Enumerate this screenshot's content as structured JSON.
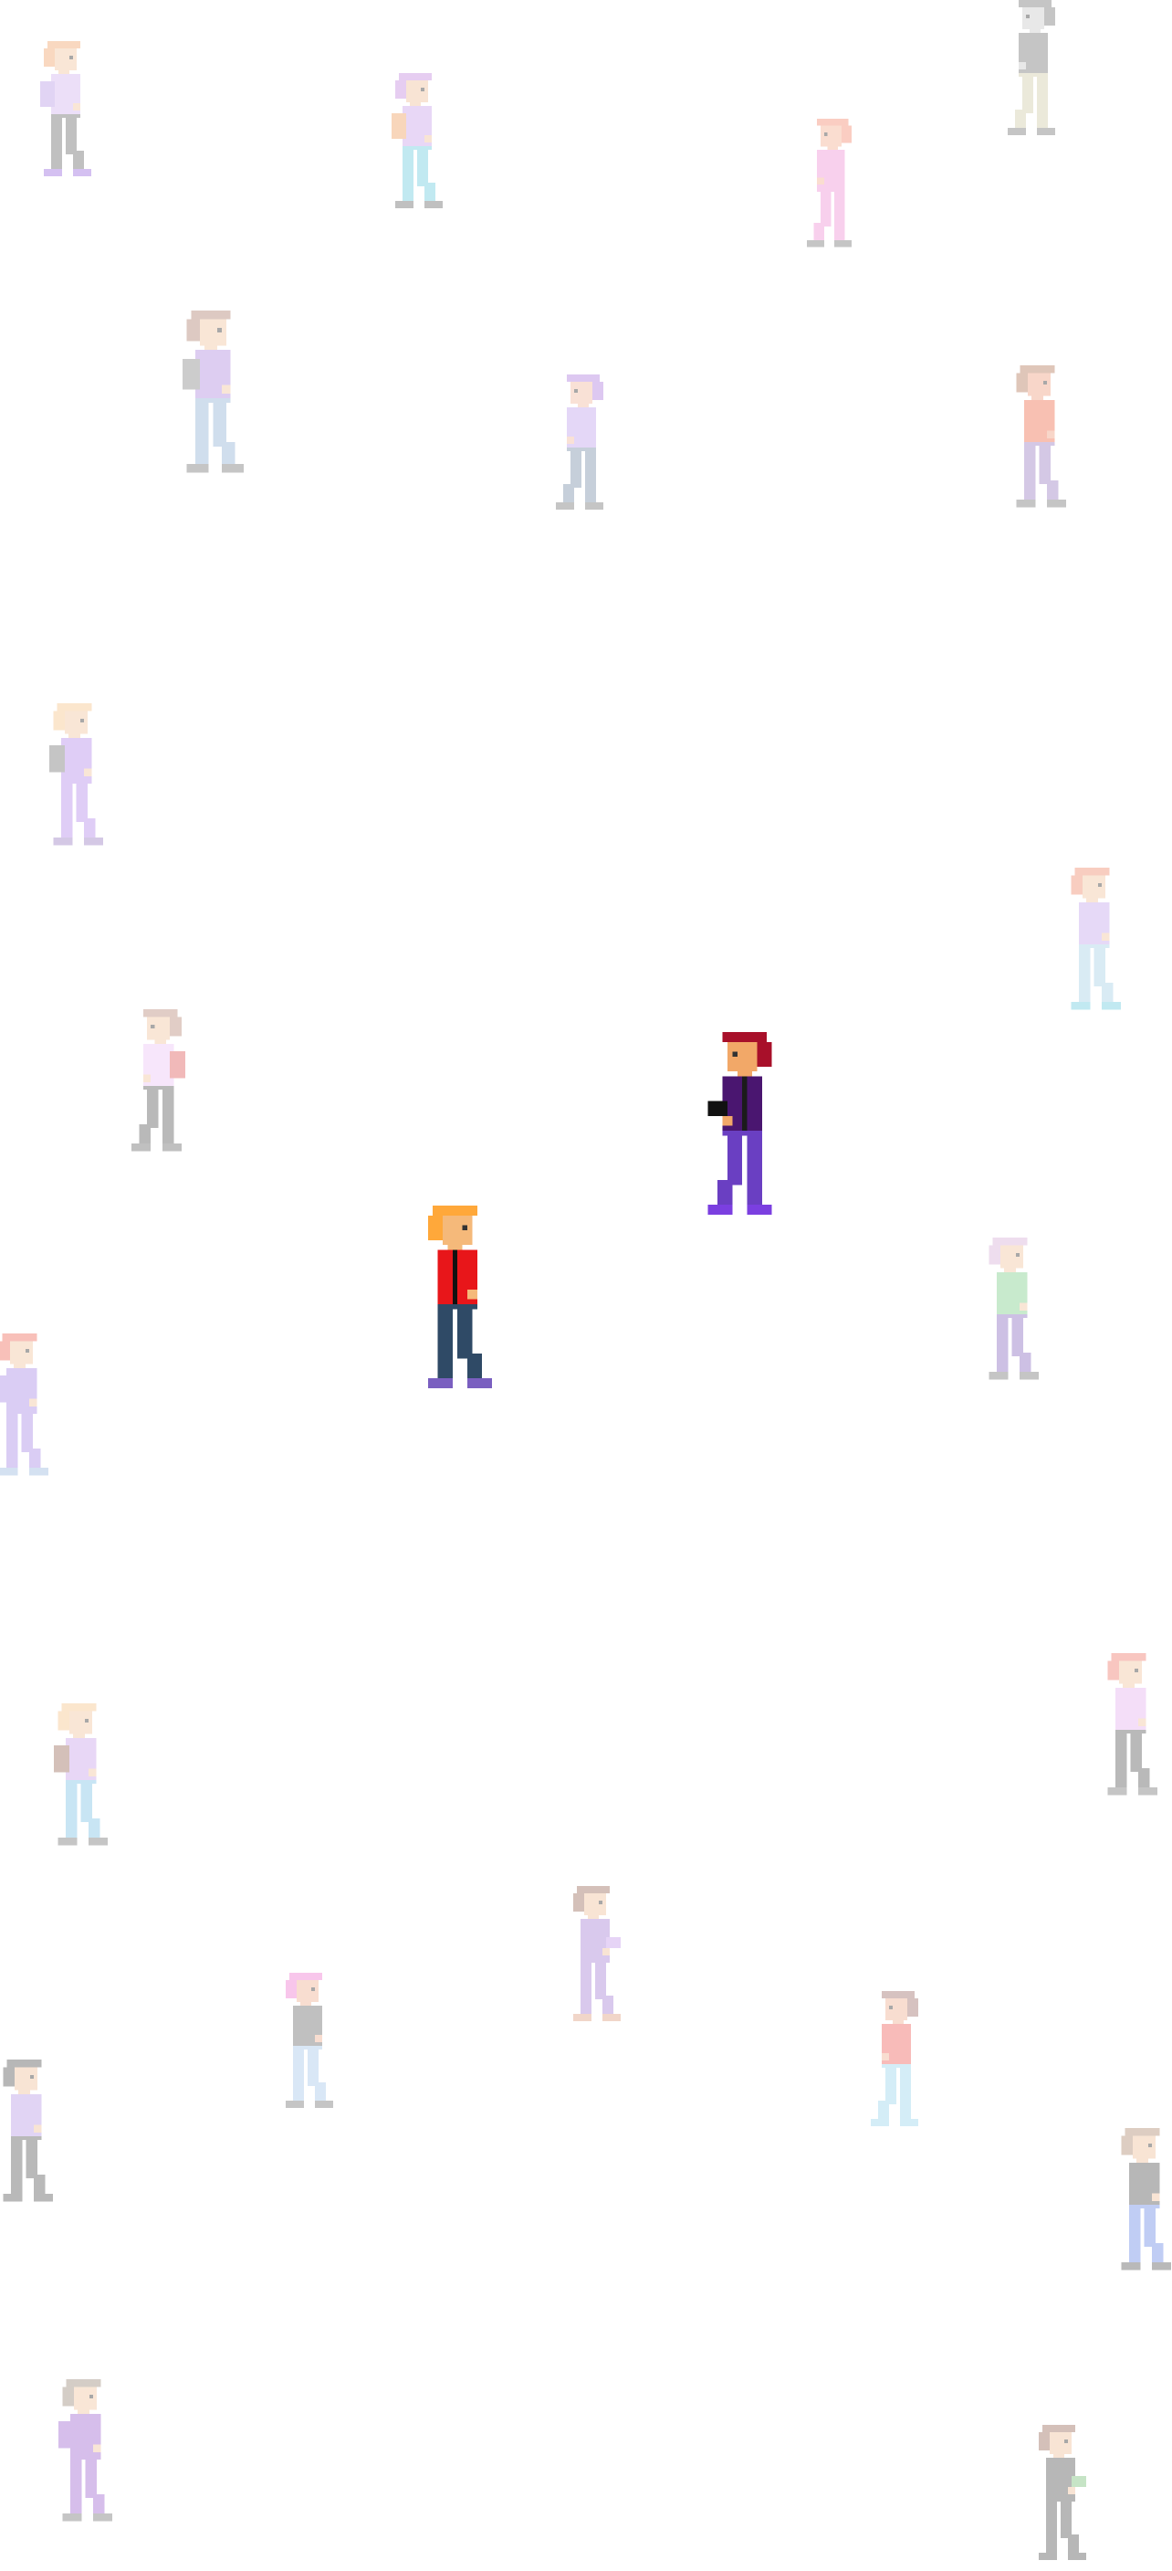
{
  "scene": {
    "background": "#ffffff",
    "description_icon": "pixel-crowd"
  },
  "focus_characters": [
    {
      "id": "hero-orange-hair",
      "hair": "#ffa83a",
      "skin": "#f5b97a",
      "shirt": "#e8161a",
      "pants": "#2f4a66",
      "shoes": "#7a5fc0",
      "strap": "#111111",
      "facing": "right",
      "emphasis": "full"
    },
    {
      "id": "npc-red-hair-purple",
      "hair": "#a8102a",
      "skin": "#f2a868",
      "shirt": "#4a1670",
      "pants": "#6a3fc2",
      "shoes": "#7b3fe0",
      "strap": "#1b1b1b",
      "facing": "left",
      "emphasis": "full",
      "holding": "black-item"
    }
  ],
  "background_characters": [
    {
      "id": "bg-01",
      "hair": "#f2a46a",
      "skin": "#f3c6a0",
      "shirt": "#d2b4f0",
      "pants": "#6a6a6a",
      "shoes": "#9a6ae0",
      "bag": "#b89ae6"
    },
    {
      "id": "bg-02",
      "hair": "#c58ae0",
      "skin": "#f0c09a",
      "shirt": "#c9a2ec",
      "pants": "#6ecbe0",
      "shoes": "#6a6a6a",
      "bag": "#f0a060"
    },
    {
      "id": "bg-03",
      "hair": "#f58a70",
      "skin": "#f4b090",
      "shirt": "#f090d6",
      "pants": "#f090d6",
      "shoes": "#777777"
    },
    {
      "id": "bg-04",
      "hair": "#777777",
      "skin": "#c9c9c9",
      "shirt": "#777777",
      "pants": "#d0cba8",
      "shoes": "#777777"
    },
    {
      "id": "bg-05",
      "hair": "#b08070",
      "skin": "#f3c6a0",
      "shirt": "#b089e0",
      "pants": "#90b2d6",
      "shoes": "#777777",
      "bag": "#888888"
    },
    {
      "id": "bg-06",
      "hair": "#b07ee0",
      "skin": "#f1b8a0",
      "shirt": "#c1a2ee",
      "pants": "#7a8ea8",
      "shoes": "#777777"
    },
    {
      "id": "bg-07",
      "hair": "#b47a5a",
      "skin": "#f0a080",
      "shirt": "#f06a4a",
      "pants": "#9a7ec2",
      "shoes": "#777777"
    },
    {
      "id": "bg-08",
      "hair": "#f6c68a",
      "skin": "#f3c6a0",
      "shirt": "#b58aeb",
      "pants": "#b58aeb",
      "shoes": "#9a7ec2",
      "bag": "#777777"
    },
    {
      "id": "bg-09",
      "hair": "#f08a6a",
      "skin": "#f3c6a0",
      "shirt": "#c5a6ee",
      "pants": "#a6d0e6",
      "shoes": "#6ecbe0"
    },
    {
      "id": "bg-10",
      "hair": "#b88a78",
      "skin": "#f3c6a0",
      "shirt": "#edc6f6",
      "pants": "#5a5a5a",
      "shoes": "#6a6a6a",
      "bag": "#e05a5a"
    },
    {
      "id": "bg-11",
      "hair": "#d8b0d8",
      "skin": "#f3c6a0",
      "shirt": "#7ecf8a",
      "pants": "#8a6ac0",
      "shoes": "#777777"
    },
    {
      "id": "bg-12",
      "hair": "#f06a5a",
      "skin": "#f3c6a0",
      "shirt": "#a88ae6",
      "pants": "#a88ae6",
      "shoes": "#9ab8e0",
      "bag": "#a88ae6"
    },
    {
      "id": "bg-13",
      "hair": "#f6c68a",
      "skin": "#f3c6a0",
      "shirt": "#c9a2ec",
      "pants": "#7ec2e6",
      "shoes": "#777777",
      "bag": "#9a6a5a"
    },
    {
      "id": "bg-14",
      "hair": "#f07a6a",
      "skin": "#f3c6a0",
      "shirt": "#e6b2f0",
      "pants": "#5a5a5a",
      "shoes": "#777777"
    },
    {
      "id": "bg-15",
      "hair": "#9a6a5a",
      "skin": "#f0c09a",
      "shirt": "#a780d6",
      "pants": "#a780d6",
      "shoes": "#e0a080",
      "holding": "#c59aec"
    },
    {
      "id": "bg-16",
      "hair": "#f07ad0",
      "skin": "#f0b090",
      "shirt": "#6a6a6a",
      "pants": "#a6c8ec",
      "shoes": "#777777"
    },
    {
      "id": "bg-17",
      "hair": "#a0706a",
      "skin": "#f0b090",
      "shirt": "#f0605a",
      "pants": "#9ad6ee",
      "shoes": "#9ad6ee"
    },
    {
      "id": "bg-18",
      "hair": "#555555",
      "skin": "#f0c09a",
      "shirt": "#b89ae6",
      "pants": "#5a5a5a",
      "shoes": "#5a5a5a"
    },
    {
      "id": "bg-19",
      "hair": "#b08a70",
      "skin": "#f0c09a",
      "shirt": "#555555",
      "pants": "#6a8ae6",
      "shoes": "#5a5a5a"
    },
    {
      "id": "bg-20",
      "hair": "#9a8a7a",
      "skin": "#f3c6a0",
      "shirt": "#a066d0",
      "pants": "#a066d0",
      "shoes": "#777777",
      "bag": "#a066d0"
    },
    {
      "id": "bg-21",
      "hair": "#9a6a5a",
      "skin": "#f0c09a",
      "shirt": "#555555",
      "pants": "#555555",
      "shoes": "#555555",
      "holding": "#7ac07a"
    }
  ]
}
